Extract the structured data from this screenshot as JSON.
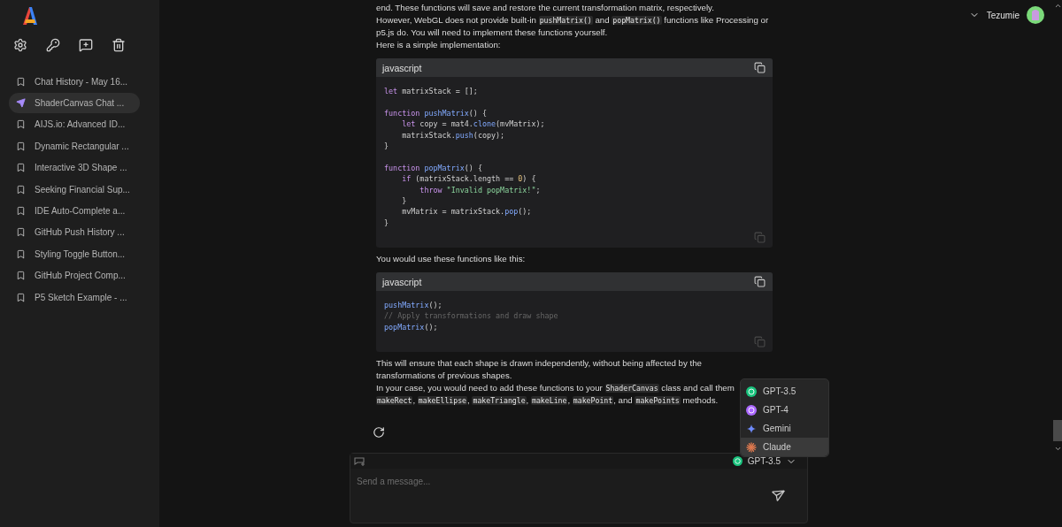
{
  "sidebar": {
    "items": [
      {
        "label": "Chat History - May 16...",
        "selected": false
      },
      {
        "label": "ShaderCanvas Chat ...",
        "selected": true
      },
      {
        "label": "AIJS.io: Advanced ID...",
        "selected": false
      },
      {
        "label": "Dynamic Rectangular ...",
        "selected": false
      },
      {
        "label": "Interactive 3D Shape ...",
        "selected": false
      },
      {
        "label": "Seeking Financial Sup...",
        "selected": false
      },
      {
        "label": "IDE Auto-Complete a...",
        "selected": false
      },
      {
        "label": "GitHub Push History ...",
        "selected": false
      },
      {
        "label": "Styling Toggle Button...",
        "selected": false
      },
      {
        "label": "GitHub Project Comp...",
        "selected": false
      },
      {
        "label": "P5 Sketch Example - ...",
        "selected": false
      }
    ]
  },
  "user": {
    "name": "Tezumie"
  },
  "message": [
    {
      "kind": "paragraph",
      "lines": [
        [
          {
            "text": "end. These functions will save and restore the current transformation matrix, respectively.",
            "code": false
          }
        ],
        [
          {
            "text": "However, WebGL does not provide built-in ",
            "code": false
          },
          {
            "text": "pushMatrix()",
            "code": true
          },
          {
            "text": " and ",
            "code": false
          },
          {
            "text": "popMatrix()",
            "code": true
          },
          {
            "text": " functions like Processing or",
            "code": false
          }
        ],
        [
          {
            "text": "p5.js do. You will need to implement these functions yourself.",
            "code": false
          }
        ],
        [
          {
            "text": "Here is a simple implementation:",
            "code": false
          }
        ]
      ]
    },
    {
      "kind": "code",
      "language": "javascript",
      "lines": [
        {
          "tokens": [
            {
              "kind": "keyword",
              "text": "let"
            },
            {
              "kind": "plain",
              "text": " matrixStack = [];"
            }
          ]
        },
        {
          "blank": true
        },
        {
          "tokens": [
            {
              "kind": "keyword",
              "text": "function "
            },
            {
              "kind": "function",
              "text": "pushMatrix"
            },
            {
              "kind": "plain",
              "text": "() {"
            }
          ]
        },
        {
          "tokens": [
            {
              "kind": "keyword",
              "text": "    let"
            },
            {
              "kind": "plain",
              "text": " copy = mat4."
            },
            {
              "kind": "function",
              "text": "clone"
            },
            {
              "kind": "plain",
              "text": "(mvMatrix);"
            }
          ]
        },
        {
          "tokens": [
            {
              "kind": "plain",
              "text": "    matrixStack."
            },
            {
              "kind": "function",
              "text": "push"
            },
            {
              "kind": "plain",
              "text": "(copy);"
            }
          ]
        },
        {
          "tokens": [
            {
              "kind": "plain",
              "text": "}"
            }
          ]
        },
        {
          "blank": true
        },
        {
          "tokens": [
            {
              "kind": "keyword",
              "text": "function "
            },
            {
              "kind": "function",
              "text": "popMatrix"
            },
            {
              "kind": "plain",
              "text": "() {"
            }
          ]
        },
        {
          "tokens": [
            {
              "kind": "keyword",
              "text": "    if"
            },
            {
              "kind": "plain",
              "text": " (matrixStack.length == "
            },
            {
              "kind": "number",
              "text": "0"
            },
            {
              "kind": "plain",
              "text": ") {"
            }
          ]
        },
        {
          "tokens": [
            {
              "kind": "keyword",
              "text": "        throw "
            },
            {
              "kind": "string",
              "text": "\"Invalid popMatrix!\""
            },
            {
              "kind": "plain",
              "text": ";"
            }
          ]
        },
        {
          "tokens": [
            {
              "kind": "plain",
              "text": "    }"
            }
          ]
        },
        {
          "tokens": [
            {
              "kind": "plain",
              "text": "    mvMatrix = matrixStack."
            },
            {
              "kind": "function",
              "text": "pop"
            },
            {
              "kind": "plain",
              "text": "();"
            }
          ]
        },
        {
          "tokens": [
            {
              "kind": "plain",
              "text": "}"
            }
          ]
        }
      ]
    },
    {
      "kind": "paragraph",
      "lines": [
        [
          {
            "text": "You would use these functions like this:",
            "code": false
          }
        ]
      ]
    },
    {
      "kind": "code",
      "language": "javascript",
      "lines": [
        {
          "tokens": [
            {
              "kind": "function",
              "text": "pushMatrix"
            },
            {
              "kind": "plain",
              "text": "();"
            }
          ]
        },
        {
          "tokens": [
            {
              "kind": "comment",
              "text": "// Apply transformations and draw shape"
            }
          ]
        },
        {
          "tokens": [
            {
              "kind": "function",
              "text": "popMatrix"
            },
            {
              "kind": "plain",
              "text": "();"
            }
          ]
        }
      ]
    },
    {
      "kind": "paragraph",
      "lines": [
        [
          {
            "text": "This will ensure that each shape is drawn independently, without being affected by the",
            "code": false
          }
        ],
        [
          {
            "text": "transformations of previous shapes.",
            "code": false
          }
        ],
        [
          {
            "text": "In your case, you would need to add these functions to your ",
            "code": false
          },
          {
            "text": "ShaderCanvas",
            "code": true
          },
          {
            "text": " class and call them",
            "code": false
          }
        ],
        [
          {
            "text": "makeRect",
            "code": true
          },
          {
            "text": ", ",
            "code": false
          },
          {
            "text": "makeEllipse",
            "code": true
          },
          {
            "text": ", ",
            "code": false
          },
          {
            "text": "makeTriangle",
            "code": true
          },
          {
            "text": ", ",
            "code": false
          },
          {
            "text": "makeLine",
            "code": true
          },
          {
            "text": ", ",
            "code": false
          },
          {
            "text": "makePoint",
            "code": true
          },
          {
            "text": ", and ",
            "code": false
          },
          {
            "text": "makePoints",
            "code": true
          },
          {
            "text": " methods.",
            "code": false
          }
        ]
      ]
    }
  ],
  "models": [
    {
      "label": "GPT-3.5",
      "kind": "gpt35",
      "selected": false
    },
    {
      "label": "GPT-4",
      "kind": "gpt4",
      "selected": false
    },
    {
      "label": "Gemini",
      "kind": "gemini",
      "selected": false
    },
    {
      "label": "Claude",
      "kind": "claude",
      "selected": true
    }
  ],
  "composer": {
    "model": "GPT-3.5",
    "placeholder": "Send a message..."
  }
}
